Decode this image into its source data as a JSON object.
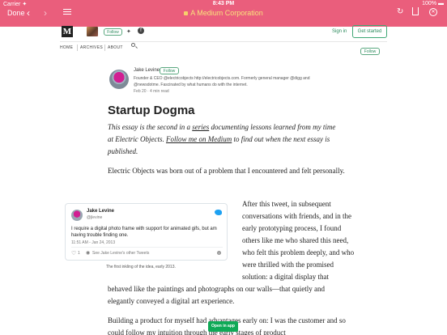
{
  "status_bar": {
    "carrier": "Carrier ✦",
    "time": "8:43 PM",
    "battery": "100% ▬"
  },
  "browser": {
    "done_label": "Done",
    "url_text": "A Medium Corporation"
  },
  "colors": {
    "bar": "#ea5e7c",
    "accent_green": "#0fa956"
  },
  "header": {
    "logo": "M",
    "pub_follow_label": "Follow",
    "signin_label": "Sign in",
    "get_started_label": "Get started"
  },
  "nav": {
    "items": [
      "HOME",
      "ARCHIVES",
      "ABOUT"
    ],
    "follow_label": "Follow"
  },
  "author": {
    "name": "Jake Levine",
    "follow_label": "Follow",
    "bio": "Founder & CEO @electricobjects http://electricobjects.com. Formerly general manager @digg and @newsdotme. Fascinated by what humans do with the internet.",
    "meta": "Feb 20 · 4 min read"
  },
  "article": {
    "title": "Startup Dogma",
    "intro_a": "This essay is the second in a ",
    "intro_link": "series",
    "intro_b": " documenting lessons learned from my time at Electric Objects. ",
    "intro_follow": "Follow me on Medium",
    "intro_c": " to find out when the next essay is published.",
    "p1": "Electric Objects was born out of a problem that I encountered and felt personally.",
    "p2": "After this tweet, in subsequent conversations with friends, and in the early prototyping process, I found others like me who shared this need, who felt this problem deeply, and who were thrilled with the promised solution: a digital display that",
    "p2b": "behaved like the paintings and photographs on our walls—that quietly and elegantly conveyed a digital art experience.",
    "p3": "Building a product for myself had advantages early on: I was the customer and so could follow my intuition through the early stages of product"
  },
  "tweet": {
    "name": "Jake Levine",
    "handle": "@jlevine",
    "text": "I require a digital photo frame with support for animated gifs, but am having trouble finding one.",
    "date": "11:51 AM - Jan 24, 2013",
    "likes": "1",
    "more": "See Jake Levine's other Tweets",
    "info": "i",
    "caption": "The first inkling of the idea, early 2013."
  },
  "open_app_label": "Open in app"
}
